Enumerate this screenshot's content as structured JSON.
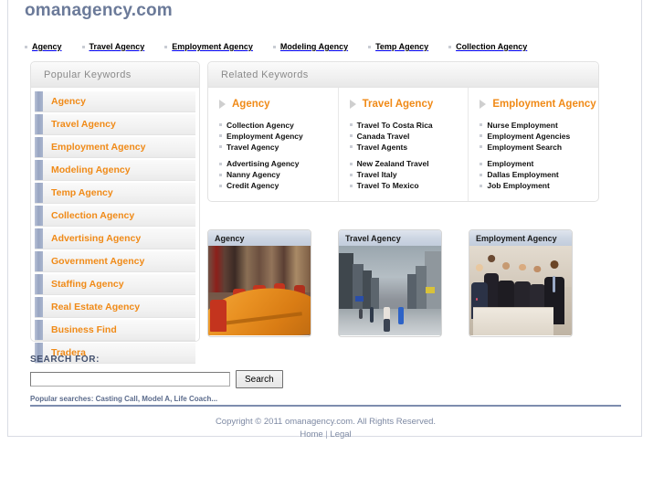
{
  "site": {
    "logo": "omanagency.com"
  },
  "topnav": {
    "items": [
      {
        "label": "Agency"
      },
      {
        "label": "Travel Agency"
      },
      {
        "label": "Employment Agency"
      },
      {
        "label": "Modeling Agency"
      },
      {
        "label": "Temp Agency"
      },
      {
        "label": "Collection Agency"
      }
    ]
  },
  "sidebar": {
    "title": "Popular Keywords",
    "items": [
      {
        "label": "Agency"
      },
      {
        "label": "Travel Agency"
      },
      {
        "label": "Employment Agency"
      },
      {
        "label": "Modeling Agency"
      },
      {
        "label": "Temp Agency"
      },
      {
        "label": "Collection Agency"
      },
      {
        "label": "Advertising Agency"
      },
      {
        "label": "Government Agency"
      },
      {
        "label": "Staffing Agency"
      },
      {
        "label": "Real Estate Agency"
      },
      {
        "label": "Business Find"
      },
      {
        "label": "Tradera"
      }
    ]
  },
  "related": {
    "title": "Related Keywords",
    "columns": [
      {
        "heading": "Agency",
        "group1": [
          {
            "label": "Collection Agency"
          },
          {
            "label": "Employment Agency"
          },
          {
            "label": "Travel Agency"
          }
        ],
        "group2": [
          {
            "label": "Advertising Agency"
          },
          {
            "label": "Nanny Agency"
          },
          {
            "label": "Credit Agency"
          }
        ]
      },
      {
        "heading": "Travel Agency",
        "group1": [
          {
            "label": "Travel To Costa Rica"
          },
          {
            "label": "Canada Travel"
          },
          {
            "label": "Travel Agents"
          }
        ],
        "group2": [
          {
            "label": "New Zealand Travel"
          },
          {
            "label": "Travel Italy"
          },
          {
            "label": "Travel To Mexico"
          }
        ]
      },
      {
        "heading": "Employment Agency",
        "group1": [
          {
            "label": "Nurse Employment"
          },
          {
            "label": "Employment Agencies"
          },
          {
            "label": "Employment Search"
          }
        ],
        "group2": [
          {
            "label": "Employment"
          },
          {
            "label": "Dallas Employment"
          },
          {
            "label": "Job Employment"
          }
        ]
      }
    ]
  },
  "cards": [
    {
      "caption": "Agency"
    },
    {
      "caption": "Travel Agency"
    },
    {
      "caption": "Employment Agency"
    }
  ],
  "search": {
    "label": "SEARCH FOR:",
    "value": "",
    "placeholder": "",
    "button": "Search",
    "popular": "Popular searches: Casting Call, Model A, Life Coach..."
  },
  "footer": {
    "copyright": "Copyright © 2011 omanagency.com. All Rights Reserved.",
    "home": "Home",
    "separator": "|",
    "legal": "Legal"
  },
  "colors": {
    "logo": "#6b7a99",
    "keyword_orange": "#f08a17",
    "accent_blue": "#98a5c2",
    "footer_rule": "#7d8cae",
    "footer_text": "#7d89a3",
    "search_label": "#44516e"
  }
}
